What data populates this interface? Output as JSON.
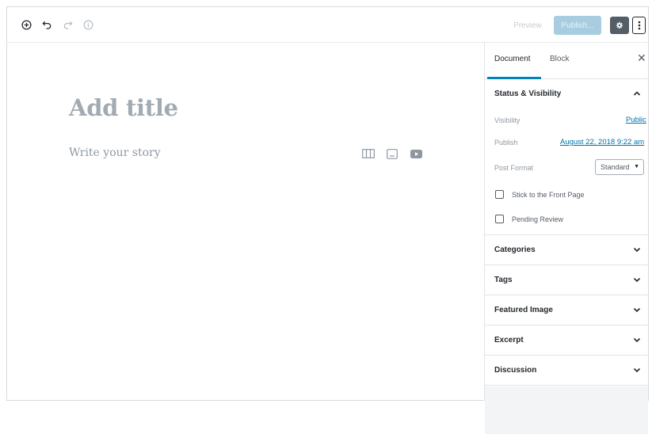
{
  "toolbar": {
    "add_block_icon": "plus-circle-icon",
    "undo_icon": "undo-icon",
    "redo_icon": "redo-icon",
    "info_icon": "info-icon",
    "preview_label": "Preview",
    "publish_label": "Publish...",
    "settings_icon": "gear-icon",
    "more_icon": "more-vertical-icon"
  },
  "editor": {
    "title_placeholder": "Add title",
    "story_placeholder": "Write your story",
    "inserters": [
      "gallery-icon",
      "image-icon",
      "video-icon"
    ]
  },
  "sidebar": {
    "tabs": [
      {
        "label": "Document",
        "active": true
      },
      {
        "label": "Block",
        "active": false
      }
    ],
    "close_icon": "close-icon",
    "status_visibility": {
      "title": "Status & Visibility",
      "expanded": true,
      "visibility_label": "Visibility",
      "visibility_value": "Public",
      "publish_label": "Publish",
      "publish_value": "August 22, 2018 9:22 am",
      "post_format_label": "Post Format",
      "post_format_value": "Standard",
      "stick_label": "Stick to the Front Page",
      "stick_checked": false,
      "pending_label": "Pending Review",
      "pending_checked": false
    },
    "panels": [
      {
        "label": "Categories",
        "expanded": false
      },
      {
        "label": "Tags",
        "expanded": false
      },
      {
        "label": "Featured Image",
        "expanded": false
      },
      {
        "label": "Excerpt",
        "expanded": false
      },
      {
        "label": "Discussion",
        "expanded": false
      }
    ]
  },
  "colors": {
    "accent": "#0085ba",
    "link": "#0073aa",
    "publish_disabled": "#a8cde0",
    "settings_active": "#555d66"
  }
}
